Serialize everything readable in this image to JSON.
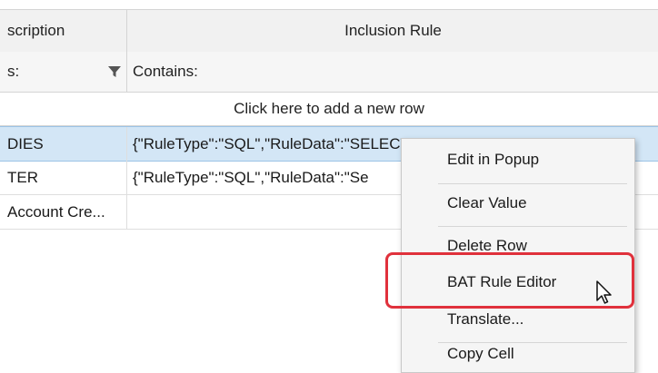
{
  "grid": {
    "columns": {
      "description": "scription",
      "inclusion_rule": "Inclusion Rule"
    },
    "filters": {
      "description": "s:",
      "inclusion_rule": "Contains:"
    },
    "add_row_text": "Click here to add a new row",
    "rows": [
      {
        "description": "DIES",
        "inclusion_rule": "{\"RuleType\":\"SQL\",\"RuleData\":\"SELECT CASE \\r\\n WHEN m.si"
      },
      {
        "description": "TER",
        "inclusion_rule": "{\"RuleType\":\"SQL\",\"RuleData\":\"Se"
      },
      {
        "description": "Account Cre...",
        "inclusion_rule": ""
      }
    ]
  },
  "context_menu": {
    "items": [
      "Edit in Popup",
      "Clear Value",
      "Delete Row",
      "BAT Rule Editor",
      "Translate...",
      "Copy Cell"
    ],
    "highlighted_item": "BAT Rule Editor"
  },
  "colors": {
    "highlight_box": "#e0313c",
    "selected_row": "#d3e6f6"
  }
}
